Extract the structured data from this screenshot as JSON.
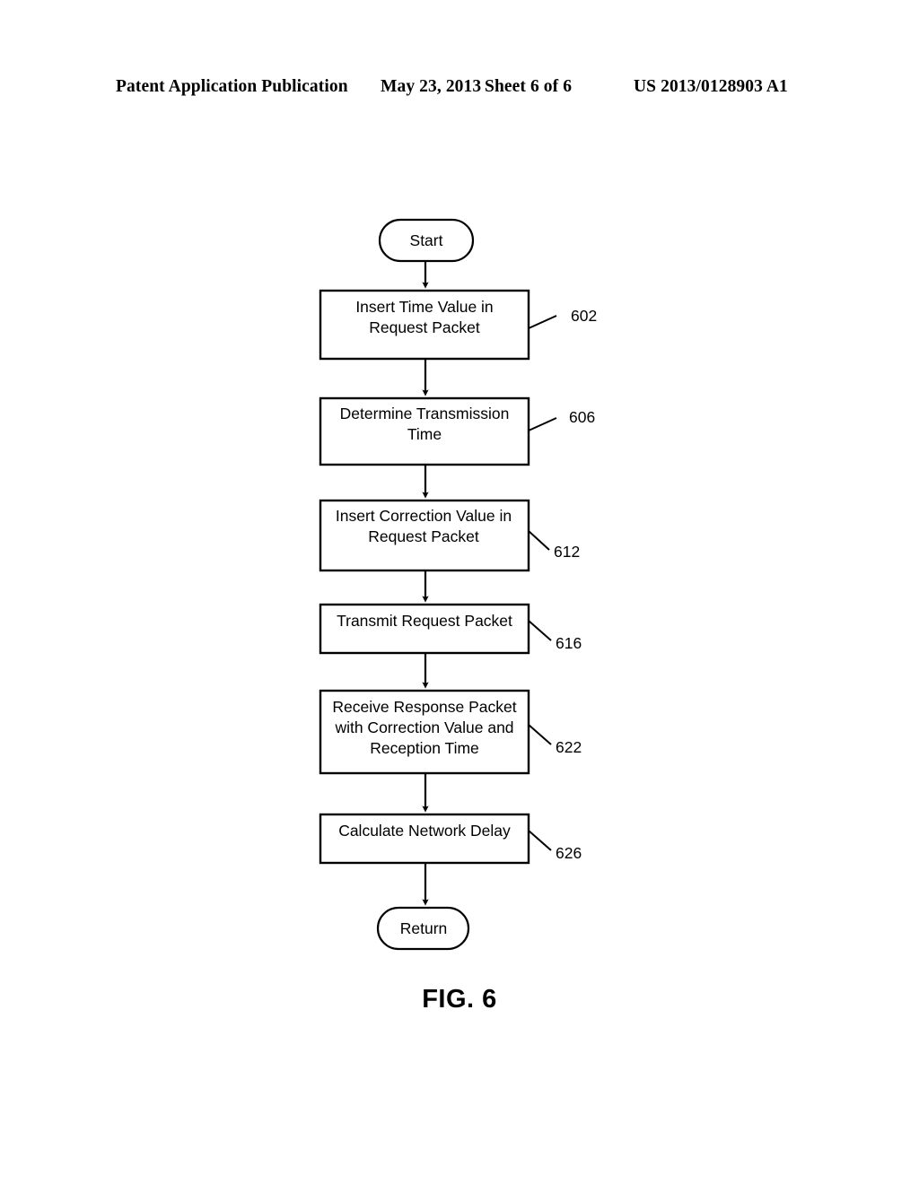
{
  "header": {
    "publication": "Patent Application Publication",
    "date": "May 23, 2013",
    "sheet": "Sheet 6 of 6",
    "patent_number": "US 2013/0128903 A1"
  },
  "figure": {
    "caption": "FIG. 6",
    "start_label": "Start",
    "end_label": "Return",
    "steps": [
      {
        "ref": "602",
        "lines": [
          "Insert Time  Value in",
          "Request Packet"
        ]
      },
      {
        "ref": "606",
        "lines": [
          "Determine Transmission",
          "Time"
        ]
      },
      {
        "ref": "612",
        "lines": [
          "Insert Correction Value in",
          "Request Packet"
        ]
      },
      {
        "ref": "616",
        "lines": [
          "Transmit Request Packet"
        ]
      },
      {
        "ref": "622",
        "lines": [
          "Receive Response Packet",
          "with Correction Value and",
          "Reception Time"
        ]
      },
      {
        "ref": "626",
        "lines": [
          "Calculate Network Delay"
        ]
      }
    ]
  },
  "colors": {
    "ink": "#000000",
    "paper": "#ffffff"
  }
}
